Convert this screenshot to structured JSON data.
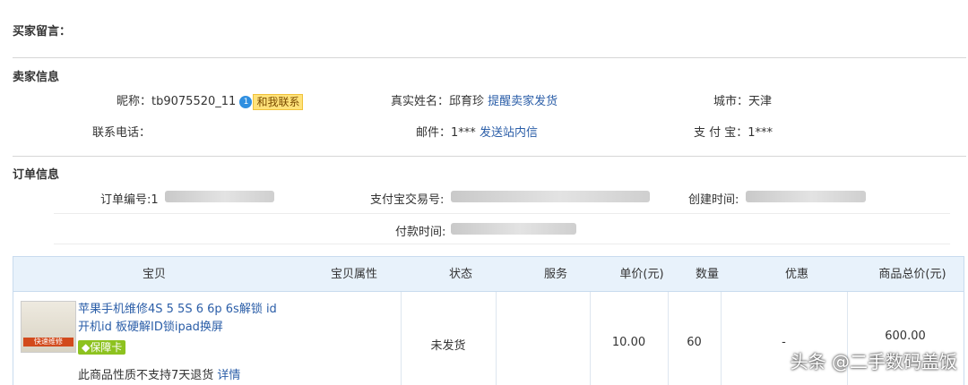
{
  "buyer_message": {
    "label": "买家留言："
  },
  "seller_info": {
    "title": "卖家信息",
    "nickname_label": "昵称：",
    "nickname_value": "tb9075520_11",
    "contact_button": "和我联系",
    "realname_label": "真实姓名：",
    "realname_value": "邱育珍",
    "remind_link": "提醒卖家发货",
    "city_label": "城市：",
    "city_value": "天津",
    "phone_label": "联系电话：",
    "phone_value": "",
    "email_label": "邮件：",
    "email_value": "1***",
    "message_link": "发送站内信",
    "alipay_label": "支 付 宝：",
    "alipay_value": "1***"
  },
  "order_info": {
    "title": "订单信息",
    "order_no_label": "订单编号:",
    "order_no_value": "1",
    "alipay_trade_label": "支付宝交易号:",
    "created_label": "创建时间:",
    "paid_label": "付款时间:"
  },
  "table": {
    "headers": [
      "宝贝",
      "宝贝属性",
      "状态",
      "服务",
      "单价(元)",
      "数量",
      "优惠",
      "商品总价(元)"
    ],
    "row": {
      "title_line1": "苹果手机维修4S 5 5S 6 6p 6s解锁 id",
      "title_line2": "开机id 板硬解ID锁ipad换屏",
      "guarantee_badge": "保障卡",
      "policy_text": "此商品性质不支持7天退货",
      "policy_link": "详情",
      "thumb_text": "快速维修",
      "status": "未发货",
      "unit_price": "10.00",
      "quantity": "60",
      "discount": "-",
      "total": "600.00"
    }
  },
  "watermark": "头条 @二手数码盖饭"
}
